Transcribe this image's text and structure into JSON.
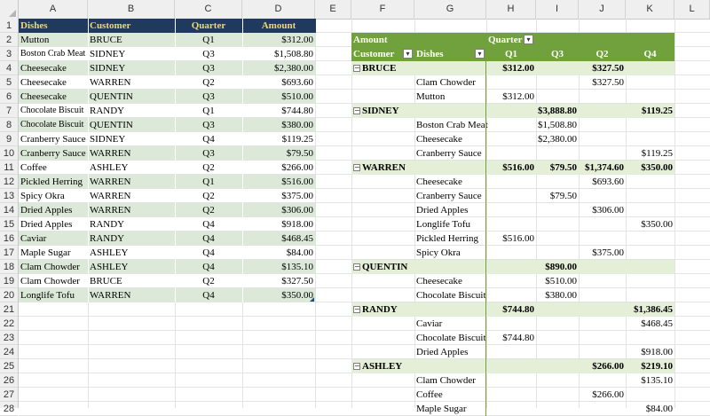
{
  "columns": [
    "A",
    "B",
    "C",
    "D",
    "E",
    "F",
    "G",
    "H",
    "I",
    "J",
    "K",
    "L"
  ],
  "rows": [
    "1",
    "2",
    "3",
    "4",
    "5",
    "6",
    "7",
    "8",
    "9",
    "10",
    "11",
    "12",
    "13",
    "14",
    "15",
    "16",
    "17",
    "18",
    "19",
    "20",
    "21",
    "22",
    "23",
    "24",
    "25",
    "26",
    "27",
    "28"
  ],
  "table": {
    "headers": [
      "Dishes",
      "Customer",
      "Quarter",
      "Amount"
    ],
    "rows": [
      [
        "Mutton",
        "BRUCE",
        "Q1",
        "$312.00"
      ],
      [
        "Boston Crab Meat",
        "SIDNEY",
        "Q3",
        "$1,508.80"
      ],
      [
        "Cheesecake",
        "SIDNEY",
        "Q3",
        "$2,380.00"
      ],
      [
        "Cheesecake",
        "WARREN",
        "Q2",
        "$693.60"
      ],
      [
        "Cheesecake",
        "QUENTIN",
        "Q3",
        "$510.00"
      ],
      [
        "Chocolate Biscuit",
        "RANDY",
        "Q1",
        "$744.80"
      ],
      [
        "Chocolate Biscuit",
        "QUENTIN",
        "Q3",
        "$380.00"
      ],
      [
        "Cranberry Sauce",
        "SIDNEY",
        "Q4",
        "$119.25"
      ],
      [
        "Cranberry Sauce",
        "WARREN",
        "Q3",
        "$79.50"
      ],
      [
        "Coffee",
        "ASHLEY",
        "Q2",
        "$266.00"
      ],
      [
        "Pickled Herring",
        "WARREN",
        "Q1",
        "$516.00"
      ],
      [
        "Spicy Okra",
        "WARREN",
        "Q2",
        "$375.00"
      ],
      [
        "Dried Apples",
        "WARREN",
        "Q2",
        "$306.00"
      ],
      [
        "Dried Apples",
        "RANDY",
        "Q4",
        "$918.00"
      ],
      [
        "Caviar",
        "RANDY",
        "Q4",
        "$468.45"
      ],
      [
        "Maple Sugar",
        "ASHLEY",
        "Q4",
        "$84.00"
      ],
      [
        "Clam Chowder",
        "ASHLEY",
        "Q4",
        "$135.10"
      ],
      [
        "Clam Chowder",
        "BRUCE",
        "Q2",
        "$327.50"
      ],
      [
        "Longlife Tofu",
        "WARREN",
        "Q4",
        "$350.00"
      ]
    ]
  },
  "pivot": {
    "values_label": "Amount",
    "column_field": "Quarter",
    "row_field_1": "Customer",
    "row_field_2": "Dishes",
    "quarters": [
      "Q1",
      "Q3",
      "Q2",
      "Q4"
    ],
    "filter_glyph": "▾",
    "collapse_glyph": "−",
    "groups": [
      {
        "name": "BRUCE",
        "totals": [
          "$312.00",
          "",
          "$327.50",
          ""
        ],
        "items": [
          {
            "dish": "Clam Chowder",
            "vals": [
              "",
              "",
              "$327.50",
              ""
            ]
          },
          {
            "dish": "Mutton",
            "vals": [
              "$312.00",
              "",
              "",
              ""
            ]
          }
        ]
      },
      {
        "name": "SIDNEY",
        "totals": [
          "",
          "$3,888.80",
          "",
          "$119.25"
        ],
        "items": [
          {
            "dish": "Boston Crab Meat",
            "vals": [
              "",
              "$1,508.80",
              "",
              ""
            ]
          },
          {
            "dish": "Cheesecake",
            "vals": [
              "",
              "$2,380.00",
              "",
              ""
            ]
          },
          {
            "dish": "Cranberry Sauce",
            "vals": [
              "",
              "",
              "",
              "$119.25"
            ]
          }
        ]
      },
      {
        "name": "WARREN",
        "totals": [
          "$516.00",
          "$79.50",
          "$1,374.60",
          "$350.00"
        ],
        "items": [
          {
            "dish": "Cheesecake",
            "vals": [
              "",
              "",
              "$693.60",
              ""
            ]
          },
          {
            "dish": "Cranberry Sauce",
            "vals": [
              "",
              "$79.50",
              "",
              ""
            ]
          },
          {
            "dish": "Dried Apples",
            "vals": [
              "",
              "",
              "$306.00",
              ""
            ]
          },
          {
            "dish": "Longlife Tofu",
            "vals": [
              "",
              "",
              "",
              "$350.00"
            ]
          },
          {
            "dish": "Pickled Herring",
            "vals": [
              "$516.00",
              "",
              "",
              ""
            ]
          },
          {
            "dish": "Spicy Okra",
            "vals": [
              "",
              "",
              "$375.00",
              ""
            ]
          }
        ]
      },
      {
        "name": "QUENTIN",
        "totals": [
          "",
          "$890.00",
          "",
          ""
        ],
        "items": [
          {
            "dish": "Cheesecake",
            "vals": [
              "",
              "$510.00",
              "",
              ""
            ]
          },
          {
            "dish": "Chocolate Biscuit",
            "vals": [
              "",
              "$380.00",
              "",
              ""
            ]
          }
        ]
      },
      {
        "name": "RANDY",
        "totals": [
          "$744.80",
          "",
          "",
          "$1,386.45"
        ],
        "items": [
          {
            "dish": "Caviar",
            "vals": [
              "",
              "",
              "",
              "$468.45"
            ]
          },
          {
            "dish": "Chocolate Biscuit",
            "vals": [
              "$744.80",
              "",
              "",
              ""
            ]
          },
          {
            "dish": "Dried Apples",
            "vals": [
              "",
              "",
              "",
              "$918.00"
            ]
          }
        ]
      },
      {
        "name": "ASHLEY",
        "totals": [
          "",
          "",
          "$266.00",
          "$219.10"
        ],
        "items": [
          {
            "dish": "Clam Chowder",
            "vals": [
              "",
              "",
              "",
              "$135.10"
            ]
          },
          {
            "dish": "Coffee",
            "vals": [
              "",
              "",
              "$266.00",
              ""
            ]
          },
          {
            "dish": "Maple Sugar",
            "vals": [
              "",
              "",
              "",
              "$84.00"
            ]
          }
        ]
      }
    ]
  },
  "colors": {
    "table_header_bg": "#1f3a5c",
    "table_header_text": "#f5d76e",
    "table_band": "#dce8d8",
    "pivot_header_bg": "#70a13c",
    "pivot_group_bg": "#e5efd8"
  }
}
